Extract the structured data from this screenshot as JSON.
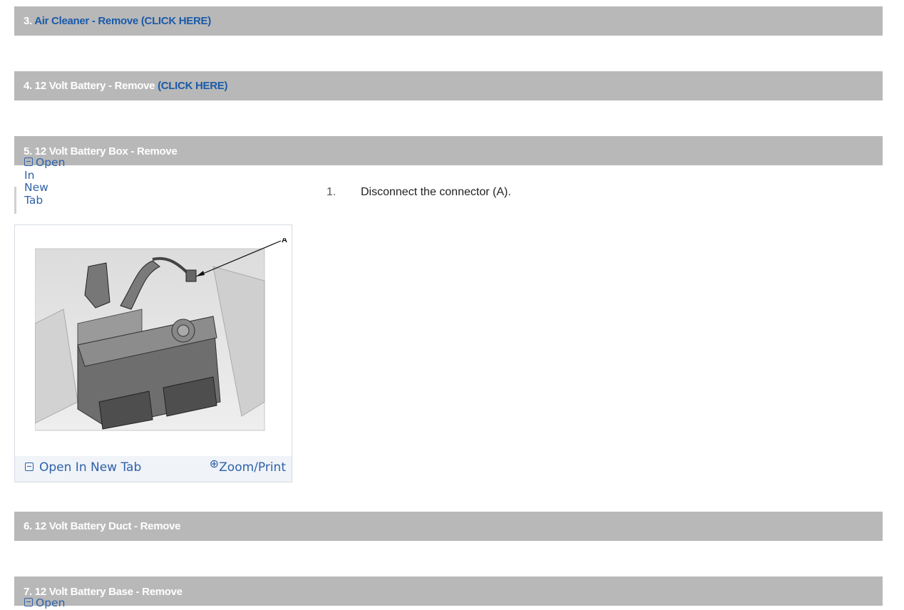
{
  "sections": [
    {
      "prefix": "3. ",
      "title": "Air Cleaner - Remove",
      "link": "(CLICK HERE)"
    },
    {
      "prefix": "4. ",
      "title": "12 Volt Battery - Remove",
      "link": "(CLICK HERE)"
    },
    {
      "prefix": "5. ",
      "title": "12 Volt Battery Box - Remove",
      "link": ""
    },
    {
      "prefix": "6. ",
      "title": "12 Volt Battery Duct - Remove",
      "link": ""
    },
    {
      "prefix": "7. ",
      "title": "12 Volt Battery Base - Remove",
      "link": ""
    }
  ],
  "side_open": {
    "line1": "Open",
    "line2": "In",
    "line3": "New",
    "line4": "Tab"
  },
  "side_open_bottom": "Open",
  "step": {
    "number": "1.",
    "text": "Disconnect the connector (A)."
  },
  "figure": {
    "callout": "A",
    "open_label": "Open In New Tab",
    "zoom_label": "Zoom/Print"
  },
  "colors": {
    "bar": "#b8b8b8",
    "link": "#1a5aa8",
    "accent": "#2e62a8"
  },
  "icons": {
    "open_tab": "open-in-new-tab-icon",
    "zoom": "zoom-icon"
  }
}
